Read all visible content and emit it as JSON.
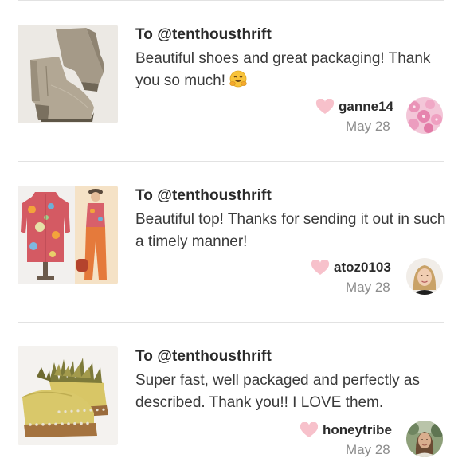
{
  "feed": {
    "items": [
      {
        "recipient": "To @tenthousthrift",
        "message": "Beautiful shoes and great packaging! Thank you so much!",
        "emoji": "hugging-face-emoji",
        "username": "ganne14",
        "date": "May 28",
        "thumbnail": "taupe-wedge-ankle-boots",
        "avatar": "pink-blossom-avatar"
      },
      {
        "recipient": "To @tenthousthrift",
        "message": "Beautiful top! Thanks for sending it out in such a timely manner!",
        "username": "atoz0103",
        "date": "May 28",
        "thumbnail": "floral-button-up-top",
        "avatar": "blonde-woman-avatar"
      },
      {
        "recipient": "To @tenthousthrift",
        "message": "Super fast, well packaged and perfectly as described. Thank you!! I LOVE them.",
        "username": "honeytribe",
        "date": "May 28",
        "thumbnail": "feather-trim-yellow-clogs",
        "avatar": "woman-outdoors-avatar"
      }
    ]
  },
  "colors": {
    "heart": "#f7c1cb",
    "divider": "#e2e2e2",
    "date": "#8c8c8c",
    "text": "#3a3a3a"
  }
}
